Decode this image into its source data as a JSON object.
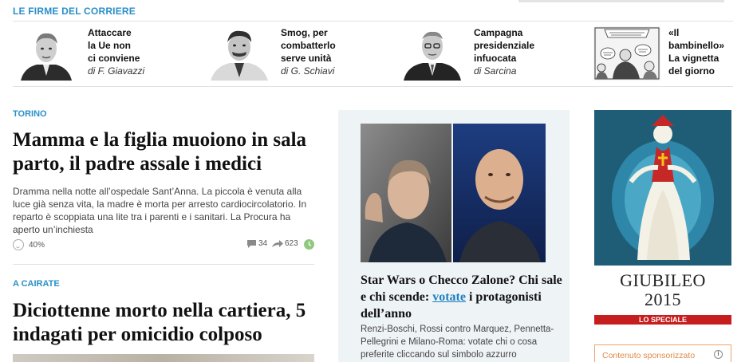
{
  "firme": {
    "label": "LE FIRME DEL CORRIERE",
    "items": [
      {
        "lines": [
          "Attaccare",
          "la Ue non",
          "ci conviene"
        ],
        "author": "di F. Giavazzi"
      },
      {
        "lines": [
          "Smog, per",
          "combatterlo",
          "serve unità"
        ],
        "author": "di G. Schiavi"
      },
      {
        "lines": [
          "Campagna",
          "presidenziale",
          "infuocata"
        ],
        "author": "di Sarcina"
      },
      {
        "lines": [
          "«Il",
          "bambinello»",
          "La vignetta",
          "del giorno"
        ],
        "author": ""
      }
    ]
  },
  "article1": {
    "kicker": "TORINO",
    "title": "Mamma e la figlia muoiono in sala parto, il padre assale i medici",
    "summary": "Dramma nella notte all’ospedale Sant’Anna. La piccola è venuta alla luce già senza vita, la madre è morta per arresto cardiocircolatorio. In reparto è scoppiata una lite tra i parenti e i sanitari. La Procura ha aperto un’inchiesta",
    "mood": "40%",
    "comments": "34",
    "shares": "623"
  },
  "article2": {
    "kicker": "A CAIRATE",
    "title": "Diciottenne morto nella cartiera, 5 indagati per omicidio colposo"
  },
  "feature": {
    "title_part1": "Star Wars o Checco Zalone? Chi sale e chi scende: ",
    "title_link": "votate",
    "title_part2": " i protagonisti dell’anno",
    "summary": "Renzi-Boschi, Rossi contro Marquez, Pennetta-Pellegrini e Milano-Roma: votate chi o cosa preferite cliccando sul simbolo azzurro"
  },
  "ad": {
    "word": "GIUBILEO",
    "year": "2015",
    "special": "LO SPECIALE",
    "sponsor": "Contenuto sponsorizzato",
    "info": "i"
  },
  "colors": {
    "accent": "#2a8fc9",
    "link": "#1f7fbf",
    "card_bg": "#eef3f6",
    "ad_bg": "#1f5d76",
    "special": "#c61e1e",
    "sponsor": "#e08a4a"
  },
  "icons": [
    "smiley-icon",
    "comment-icon",
    "share-arrow-icon",
    "clock-icon",
    "info-icon"
  ]
}
